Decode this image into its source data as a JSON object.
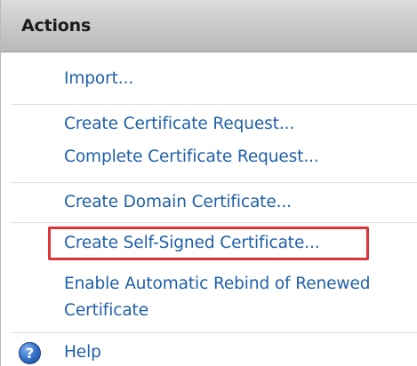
{
  "panel": {
    "title": "Actions"
  },
  "actions": {
    "import": "Import...",
    "create_certificate_request": "Create Certificate Request...",
    "complete_certificate_request": "Complete Certificate Request...",
    "create_domain_certificate": "Create Domain Certificate...",
    "create_self_signed_certificate": "Create Self-Signed Certificate...",
    "enable_rebind_line1": "Enable Automatic Rebind of Renewed",
    "enable_rebind_line2": "Certificate",
    "help": "Help"
  },
  "icons": {
    "help": "help-icon"
  },
  "colors": {
    "link": "#1f5fa8",
    "highlight": "#d9353a",
    "header_bg": "#c8c8c8"
  }
}
